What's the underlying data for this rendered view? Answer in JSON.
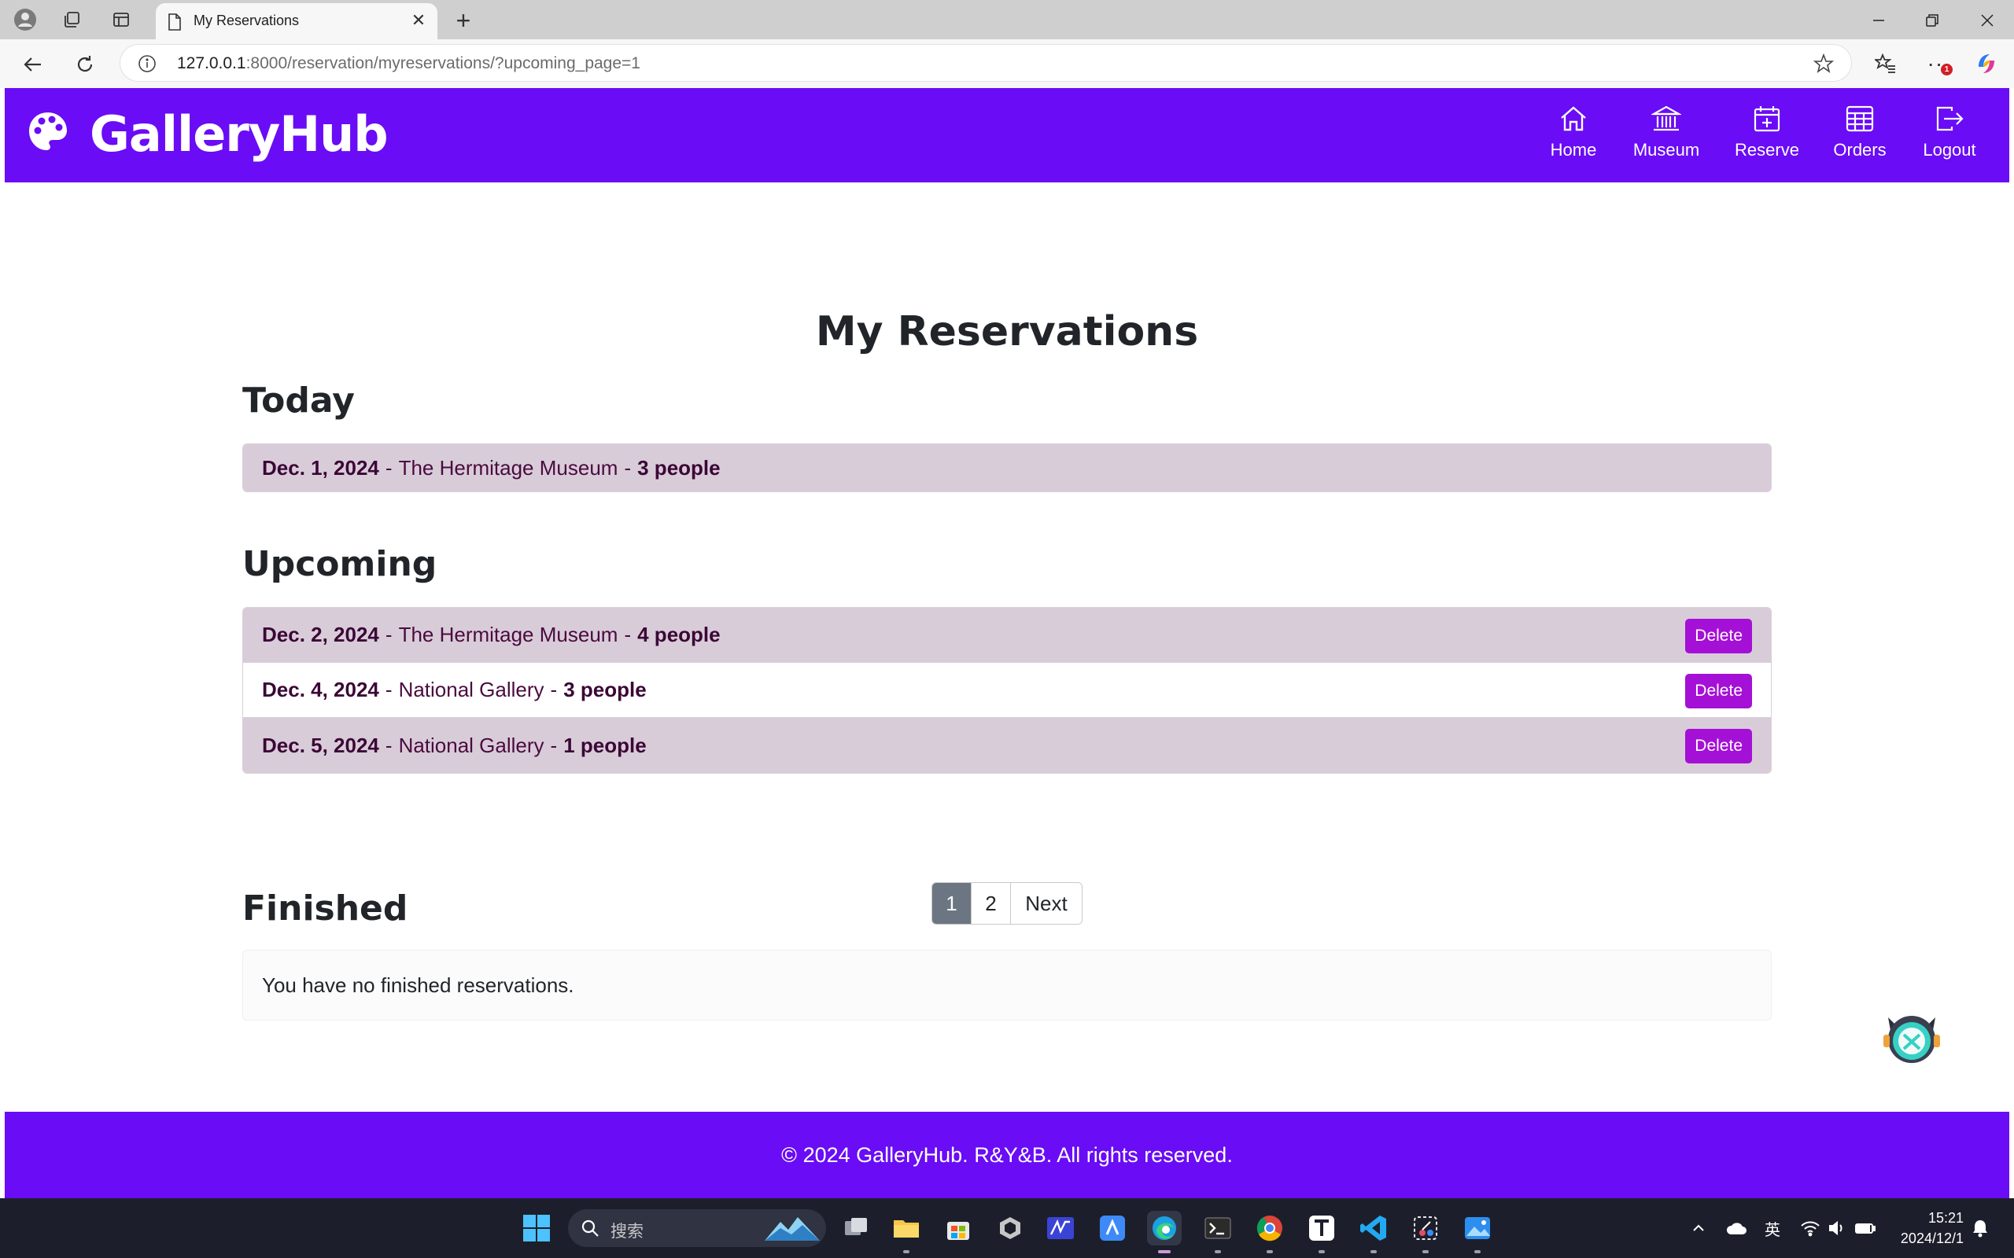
{
  "browser": {
    "tab_title": "My Reservations",
    "url_host": "127.0.0.1",
    "url_path": ":8000/reservation/myreservations/?upcoming_page=1"
  },
  "site": {
    "brand": "GalleryHub",
    "nav": [
      {
        "label": "Home"
      },
      {
        "label": "Museum"
      },
      {
        "label": "Reserve"
      },
      {
        "label": "Orders"
      },
      {
        "label": "Logout"
      }
    ],
    "page_title": "My Reservations",
    "today": {
      "heading": "Today",
      "items": [
        {
          "date": "Dec. 1, 2024",
          "museum": "The Hermitage Museum",
          "people": "3 people"
        }
      ]
    },
    "upcoming": {
      "heading": "Upcoming",
      "delete_label": "Delete",
      "items": [
        {
          "date": "Dec. 2, 2024",
          "museum": "The Hermitage Museum",
          "people": "4 people"
        },
        {
          "date": "Dec. 4, 2024",
          "museum": "National Gallery",
          "people": "3 people"
        },
        {
          "date": "Dec. 5, 2024",
          "museum": "National Gallery",
          "people": "1 people"
        }
      ]
    },
    "pagination": {
      "pages": [
        "1",
        "2"
      ],
      "current": "1",
      "next": "Next"
    },
    "finished": {
      "heading": "Finished",
      "empty_text": "You have no finished reservations."
    },
    "footer": "© 2024 GalleryHub. R&Y&B. All rights reserved."
  },
  "taskbar": {
    "search_placeholder": "搜索",
    "ime": "英",
    "time": "15:21",
    "date": "2024/12/1"
  },
  "colors": {
    "brand": "#6a0cf5",
    "delete": "#a510d6",
    "row_shade": "#d9ccd9",
    "page_active": "#6c7683"
  }
}
